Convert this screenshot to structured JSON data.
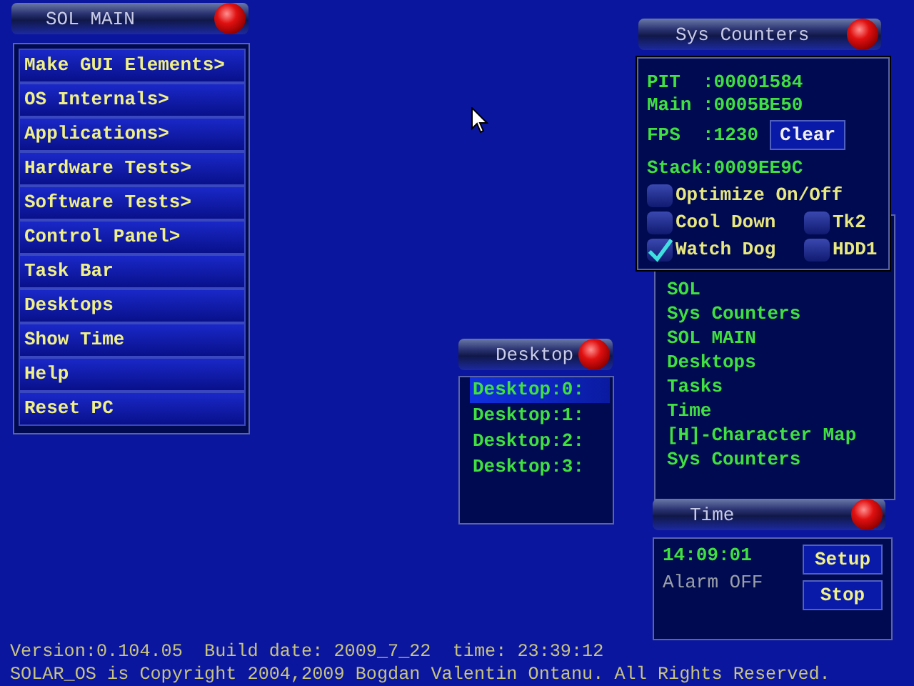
{
  "sol_main": {
    "title": "SOL MAIN",
    "items": [
      {
        "label": "Make GUI Elements>"
      },
      {
        "label": "OS Internals>"
      },
      {
        "label": "Applications>"
      },
      {
        "label": "Hardware Tests>"
      },
      {
        "label": "Software Tests>"
      },
      {
        "label": "Control Panel>"
      },
      {
        "label": "Task Bar"
      },
      {
        "label": "Desktops"
      },
      {
        "label": "Show Time"
      },
      {
        "label": "Help"
      },
      {
        "label": "Reset PC"
      }
    ]
  },
  "sys_counters": {
    "title": "Sys Counters",
    "counters": [
      {
        "label": "PIT",
        "value": ":00001584"
      },
      {
        "label": "Main",
        "value": ":0005BE50"
      },
      {
        "label": "FPS",
        "value": ":1230",
        "button": "Clear"
      },
      {
        "label": "Stack",
        "value": ":0009EE9C"
      }
    ],
    "option_rows": [
      {
        "options": [
          {
            "label": "Optimize On/Off",
            "checked": false
          }
        ]
      },
      {
        "options": [
          {
            "label": "Cool Down",
            "checked": false
          },
          {
            "label": "Tk2",
            "checked": false
          }
        ]
      },
      {
        "options": [
          {
            "label": "Watch Dog",
            "checked": true
          },
          {
            "label": "HDD1",
            "checked": false
          }
        ]
      }
    ]
  },
  "tasks": {
    "items": [
      "SOL",
      "Sys Counters",
      "SOL MAIN",
      "Desktops",
      "Tasks",
      "Time",
      "[H]-Character Map",
      "Sys Counters"
    ]
  },
  "desktop": {
    "title": "Desktop",
    "items": [
      {
        "label": "Desktop:0:",
        "selected": true
      },
      {
        "label": "Desktop:1:",
        "selected": false
      },
      {
        "label": "Desktop:2:",
        "selected": false
      },
      {
        "label": "Desktop:3:",
        "selected": false
      }
    ]
  },
  "time": {
    "title": "Time",
    "clock": "14:09:01",
    "alarm": "Alarm OFF",
    "buttons": [
      "Setup",
      "Stop"
    ]
  },
  "footer": [
    "Version:0.104.05  Build date: 2009_7_22  time: 23:39:12",
    "SOLAR_OS is Copyright 2004,2009 Bogdan Valentin Ontanu. All Rights Reserved."
  ]
}
